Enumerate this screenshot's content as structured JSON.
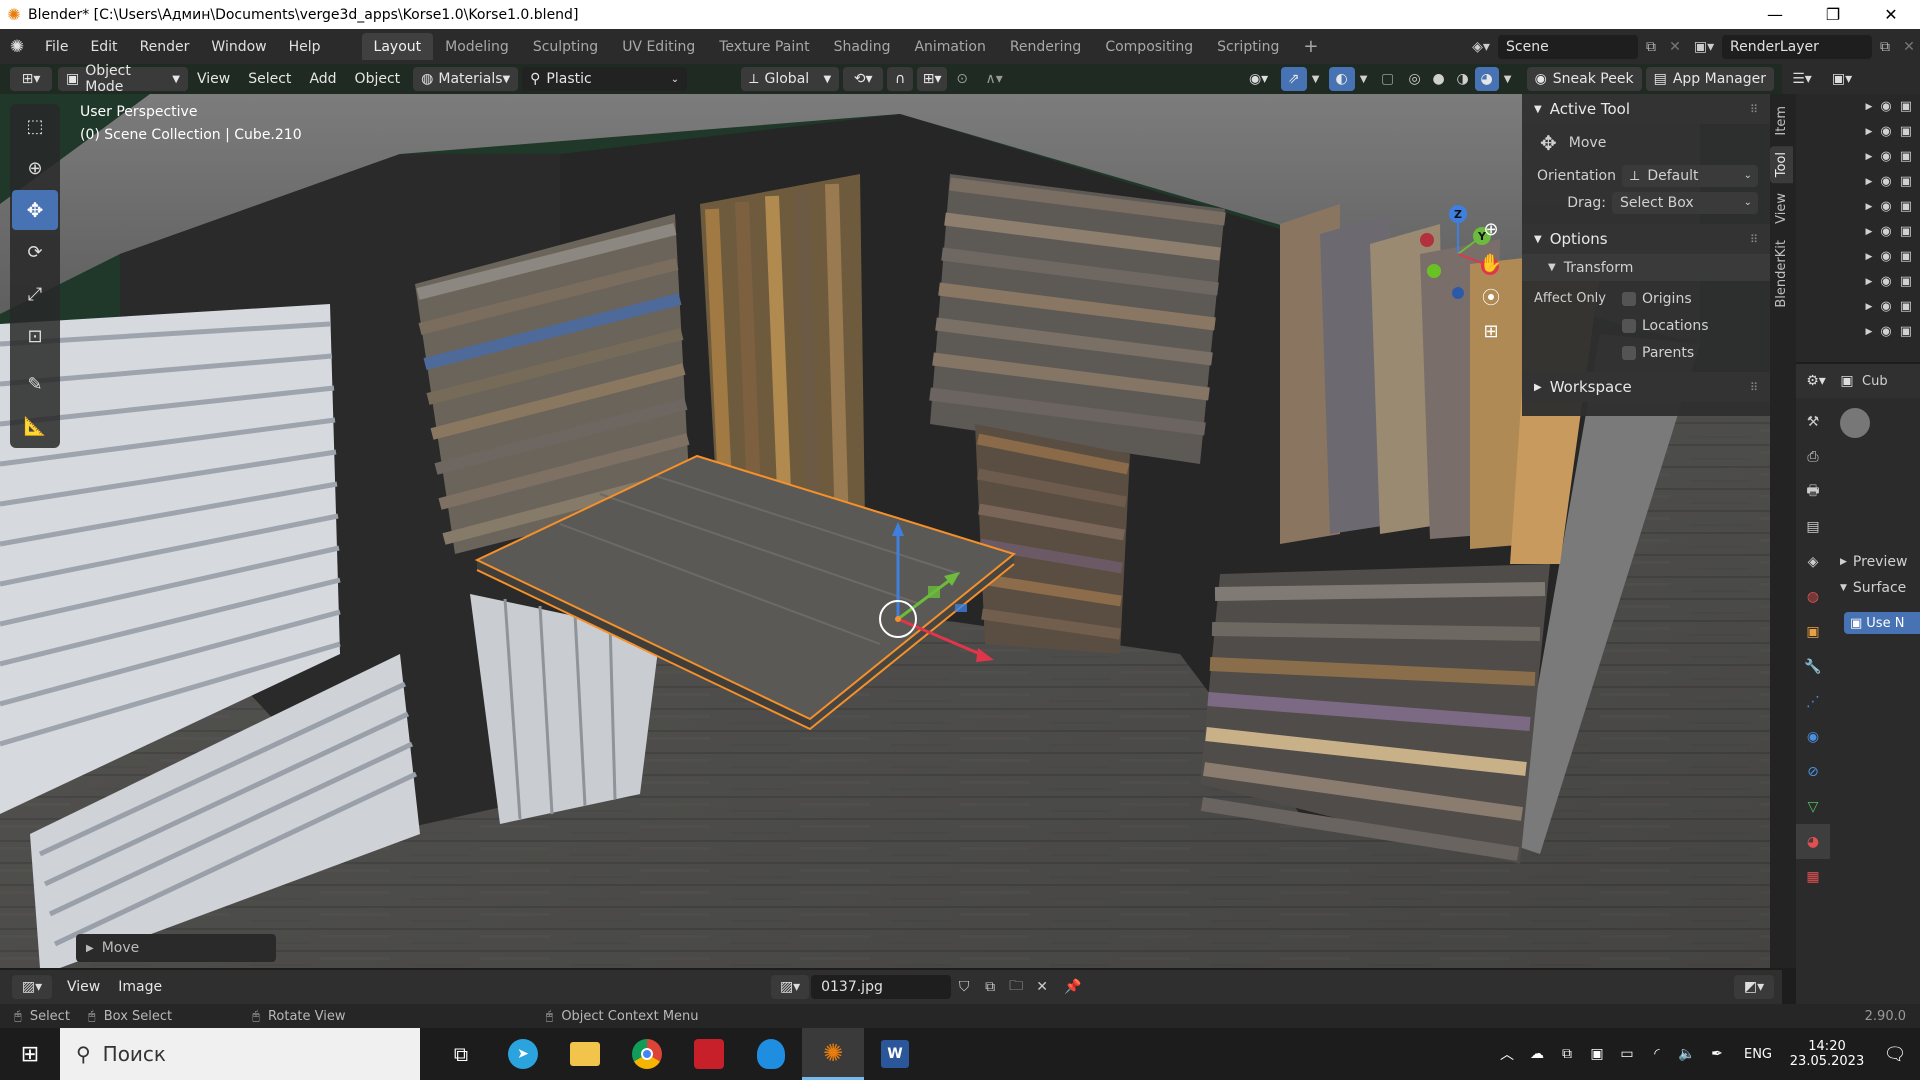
{
  "titlebar": {
    "title": "Blender* [C:\\Users\\Админ\\Documents\\verge3d_apps\\Korse1.0\\Korse1.0.blend]",
    "minimize": "—",
    "maximize": "❐",
    "close": "✕"
  },
  "menu": {
    "items": [
      "File",
      "Edit",
      "Render",
      "Window",
      "Help"
    ],
    "workspaces": [
      "Layout",
      "Modeling",
      "Sculpting",
      "UV Editing",
      "Texture Paint",
      "Shading",
      "Animation",
      "Rendering",
      "Compositing",
      "Scripting"
    ],
    "active_workspace": "Layout",
    "add_tab": "+",
    "scene": "Scene",
    "render_layer": "RenderLayer"
  },
  "header": {
    "mode": "Object Mode",
    "menus": [
      "View",
      "Select",
      "Add",
      "Object"
    ],
    "material_slot": "Materials",
    "material_name": "Plastic",
    "orientation": "Global",
    "sneak_peek": "Sneak Peek",
    "app_manager": "App Manager"
  },
  "viewport": {
    "perspective": "User Perspective",
    "collection": "(0) Scene Collection | Cube.210",
    "last_op": "Move",
    "gizmo": {
      "x": "X",
      "y": "Y",
      "z": "Z"
    }
  },
  "npanel": {
    "tabs": [
      "Item",
      "Tool",
      "View",
      "BlenderKit"
    ],
    "active_tab": "Tool",
    "active_tool_title": "Active Tool",
    "tool_name": "Move",
    "orientation_label": "Orientation",
    "orientation_value": "Default",
    "drag_label": "Drag:",
    "drag_value": "Select Box",
    "options_title": "Options",
    "transform_title": "Transform",
    "affect_only": "Affect Only",
    "origins": "Origins",
    "locations": "Locations",
    "parents": "Parents",
    "workspace_title": "Workspace"
  },
  "properties": {
    "object_name": "Cub",
    "preview": "Preview",
    "surface": "Surface",
    "use_nodes": "Use N"
  },
  "image_editor": {
    "view": "View",
    "image": "Image",
    "image_name": "0137.jpg"
  },
  "status": {
    "select": "Select",
    "box_select": "Box Select",
    "rotate_view": "Rotate View",
    "context_menu": "Object Context Menu",
    "version": "2.90.0"
  },
  "taskbar": {
    "search": "Поиск",
    "lang": "ENG",
    "time": "14:20",
    "date": "23.05.2023"
  },
  "colors": {
    "accent": "#4772b3",
    "selection": "#f5902a",
    "bg_green": "#1f3d2a"
  }
}
